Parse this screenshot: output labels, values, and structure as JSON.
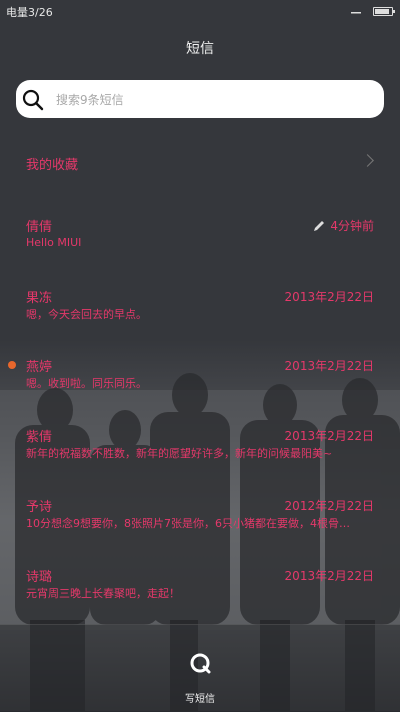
{
  "status_bar": {
    "carrier": "电量3/26",
    "battery_level": 0.9
  },
  "header": {
    "title": "短信"
  },
  "search": {
    "placeholder": "搜索9条短信"
  },
  "favorites": {
    "label": "我的收藏"
  },
  "messages": [
    {
      "name": "倩倩",
      "time": "4分钟前",
      "snippet": "Hello MIUI",
      "unread": false,
      "draft": true
    },
    {
      "name": "果冻",
      "time": "2013年2月22日",
      "snippet": "嗯，今天会回去的早点。",
      "unread": false,
      "draft": false
    },
    {
      "name": "燕婷",
      "time": "2013年2月22日",
      "snippet": "嗯。收到啦。同乐同乐。",
      "unread": true,
      "draft": false
    },
    {
      "name": "紫倩",
      "time": "2013年2月22日",
      "snippet": "新年的祝福数不胜数，新年的愿望好许多，新年的问候最阳美~",
      "unread": false,
      "draft": false
    },
    {
      "name": "予诗",
      "time": "2012年2月22日",
      "snippet": "10分想念9想要你，8张照片7张是你，6只小猪都在要做，4根骨…",
      "unread": false,
      "draft": false
    },
    {
      "name": "诗璐",
      "time": "2013年2月22日",
      "snippet": "元宵周三晚上长春聚吧，走起！",
      "unread": false,
      "draft": false
    }
  ],
  "bottom_bar": {
    "compose_label": "写短信"
  },
  "colors": {
    "accent": "#e5386a",
    "unread_dot": "#e8672c"
  }
}
